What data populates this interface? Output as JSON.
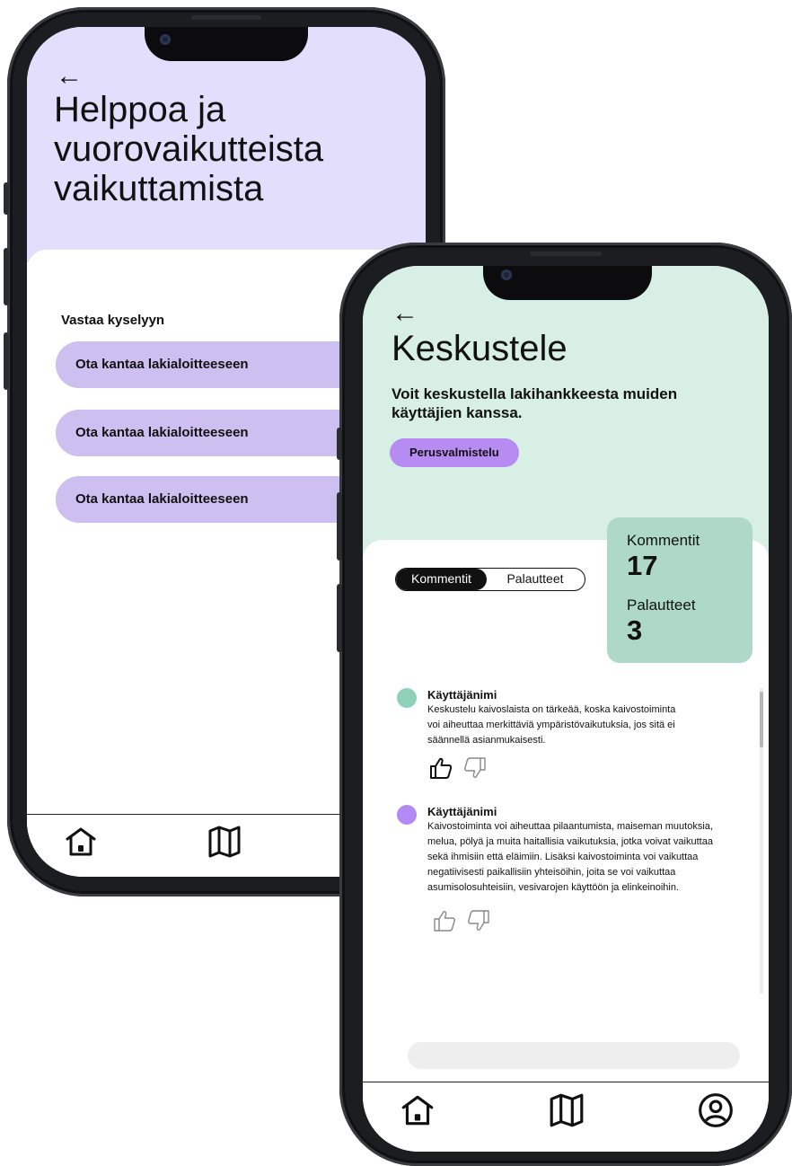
{
  "phone1": {
    "back_glyph": "←",
    "title": "Helppoa ja vuorovaikutteista vaikuttamista",
    "section_label": "Vastaa kyselyyn",
    "survey_buttons": [
      {
        "label": "Ota kantaa lakialoitteeseen"
      },
      {
        "label": "Ota kantaa lakialoitteeseen"
      },
      {
        "label": "Ota kantaa lakialoitteeseen"
      }
    ],
    "nav": [
      "home-icon",
      "map-icon"
    ]
  },
  "phone2": {
    "back_glyph": "←",
    "title": "Keskustele",
    "subtitle": "Voit keskustella lakihankkeesta muiden käyttäjien kanssa.",
    "chip_label": "Perusvalmistelu",
    "stats": {
      "comments_label": "Kommentit",
      "comments_count": "17",
      "feedback_label": "Palautteet",
      "feedback_count": "3"
    },
    "tabs": {
      "active": "Kommentit",
      "inactive": "Palautteet"
    },
    "comments": [
      {
        "user": "Käyttäjänimi",
        "avatar_color": "#8fd1b8",
        "lines": [
          "Keskustelu kaivoslaista on tärkeää, koska kaivostoiminta",
          "voi aiheuttaa merkittäviä ympäristövaikutuksia, jos sitä ei",
          "säännellä asianmukaisesti."
        ],
        "liked": true
      },
      {
        "user": "Käyttäjänimi",
        "avatar_color": "#b18af3",
        "lines": [
          "Kaivostoiminta voi aiheuttaa pilaantumista, maiseman muutoksia,",
          "melua, pölyä ja muita haitallisia vaikutuksia, jotka voivat vaikuttaa",
          "sekä ihmisiin että eläimiin. Lisäksi kaivostoiminta voi vaikuttaa",
          "negatiivisesti paikallisiin yhteisöihin, joita se voi vaikuttaa",
          "asumisolosuhteisiin, vesivarojen käyttöön ja elinkeinoihin."
        ],
        "liked": false
      }
    ],
    "nav": [
      "home-icon",
      "map-icon",
      "profile-icon"
    ]
  },
  "colors": {
    "phone1_header": "#e2defb",
    "survey_button": "#cdbff0",
    "phone2_header": "#d8efe6",
    "stats_card": "#aed9c8",
    "chip": "#b78cf2"
  }
}
